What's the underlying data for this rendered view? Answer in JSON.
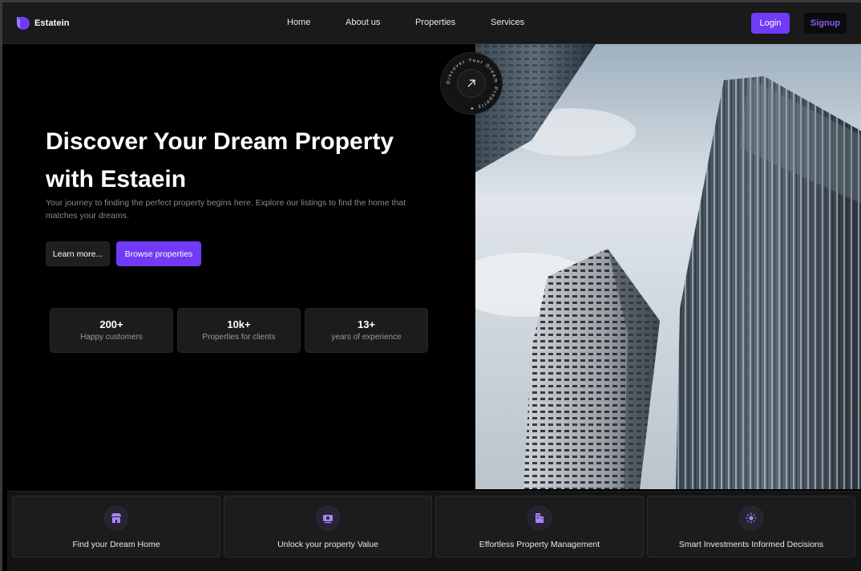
{
  "brand": {
    "name": "Estatein",
    "accent": "#703bf7"
  },
  "nav": {
    "items": [
      {
        "label": "Home"
      },
      {
        "label": "About us"
      },
      {
        "label": "Properties"
      },
      {
        "label": "Services"
      }
    ],
    "login_label": "Login",
    "signup_label": "Signup"
  },
  "hero": {
    "title": "Discover Your Dream Property with Estaein",
    "subtitle": "Your journey to finding the perfect property begins here. Explore our listings to find the home that matches your dreams.",
    "learn_more_label": "Learn more...",
    "browse_label": "Browse properties",
    "badge_text": "Discover Your Dream Property ✦ ",
    "stats": [
      {
        "value": "200+",
        "label": "Happy customers"
      },
      {
        "value": "10k+",
        "label": "Properties for clients"
      },
      {
        "value": "13+",
        "label": "years of experience"
      }
    ]
  },
  "features": [
    {
      "label": "Find your Dream Home",
      "icon": "storefront-icon"
    },
    {
      "label": "Unlock your property Value",
      "icon": "cash-icon"
    },
    {
      "label": "Effortless Property Management",
      "icon": "building-icon"
    },
    {
      "label": "Smart Investments Informed Decisions",
      "icon": "sun-icon"
    }
  ]
}
